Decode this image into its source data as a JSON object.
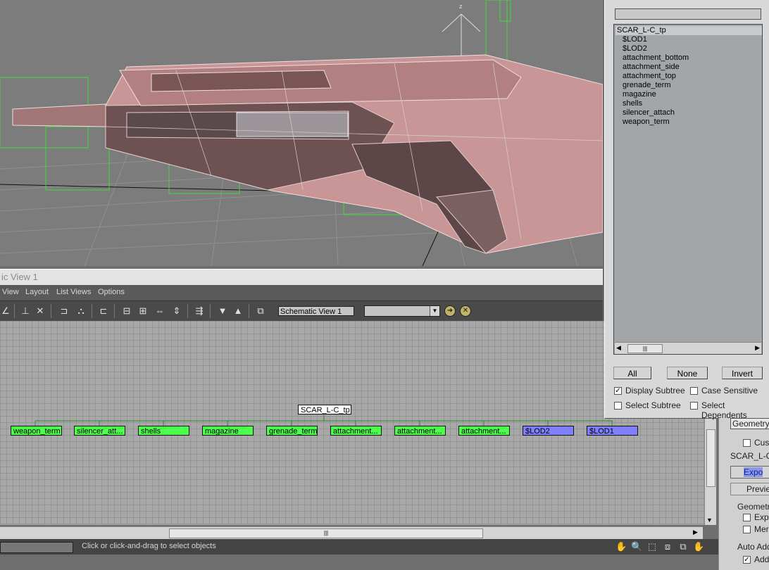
{
  "viewport": {
    "axis_label": "z"
  },
  "schematic": {
    "title": "ic View 1",
    "menu": [
      "View",
      "Layout",
      "List Views",
      "Options"
    ],
    "view_name": "Schematic View 1",
    "root_node": "SCAR_L-C_tp",
    "nodes": [
      {
        "label": "weapon_term",
        "color": "green"
      },
      {
        "label": "silencer_att...",
        "color": "green"
      },
      {
        "label": "shells",
        "color": "green"
      },
      {
        "label": "magazine",
        "color": "green"
      },
      {
        "label": "grenade_term",
        "color": "green"
      },
      {
        "label": "attachment...",
        "color": "green"
      },
      {
        "label": "attachment...",
        "color": "green"
      },
      {
        "label": "attachment...",
        "color": "green"
      },
      {
        "label": "$LOD2",
        "color": "blue"
      },
      {
        "label": "$LOD1",
        "color": "blue"
      }
    ],
    "status_text": "Click or click-and-drag to select objects"
  },
  "select_dialog": {
    "items": [
      "SCAR_L-C_tp",
      "$LOD1",
      "$LOD2",
      "attachment_bottom",
      "attachment_side",
      "attachment_top",
      "grenade_term",
      "magazine",
      "shells",
      "silencer_attach",
      "weapon_term"
    ],
    "buttons": {
      "all": "All",
      "none": "None",
      "invert": "Invert"
    },
    "options": {
      "display_subtree": "Display Subtree",
      "case_sensitive": "Case Sensitive",
      "select_subtree": "Select Subtree",
      "select_dependents": "Select Dependents"
    }
  },
  "right_panel": {
    "geometry_field": "Geometry [",
    "custom": "Cust",
    "scar_label": "SCAR_L-C_",
    "export_button": "Expo",
    "preview_button": "Previe",
    "geometry_group": "Geometry",
    "export_check": "Expo",
    "merge_check": "Merg",
    "auto_add_group": "Auto Add",
    "add_check": "Add"
  },
  "colors": {
    "node_green": "#4dff4d",
    "node_blue": "#8080ff",
    "mesh": "#c89696"
  }
}
